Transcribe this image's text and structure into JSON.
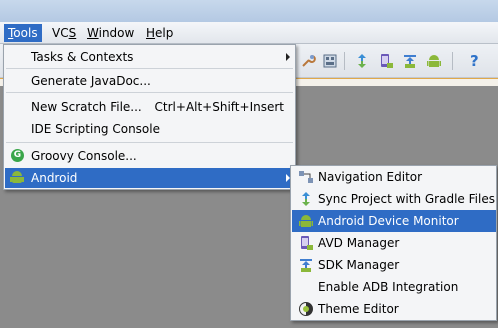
{
  "menubar": {
    "items": [
      "Tools",
      "VCS",
      "Window",
      "Help"
    ],
    "open": "Tools",
    "mnemonics": [
      "T",
      "S",
      "W",
      "H"
    ]
  },
  "tools_menu": {
    "items": [
      {
        "label": "Tasks & Contexts",
        "has_submenu": true
      },
      {
        "label": "Generate JavaDoc...",
        "has_submenu": false
      },
      {
        "label": "New Scratch File...",
        "shortcut": "Ctrl+Alt+Shift+Insert"
      },
      {
        "label": "IDE Scripting Console"
      },
      {
        "label": "Groovy Console...",
        "icon": "groovy-icon"
      },
      {
        "label": "Android",
        "icon": "android-icon",
        "has_submenu": true,
        "selected": true
      }
    ]
  },
  "android_submenu": {
    "items": [
      {
        "label": "Navigation Editor",
        "icon": "navigation-editor-icon"
      },
      {
        "label": "Sync Project with Gradle Files",
        "icon": "gradle-sync-icon"
      },
      {
        "label": "Android Device Monitor",
        "icon": "android-icon",
        "selected": true
      },
      {
        "label": "AVD Manager",
        "icon": "avd-manager-icon"
      },
      {
        "label": "SDK Manager",
        "icon": "sdk-manager-icon"
      },
      {
        "label": "Enable ADB Integration",
        "icon": ""
      },
      {
        "label": "Theme Editor",
        "icon": "theme-editor-icon"
      }
    ]
  },
  "toolbar": {
    "help_label": "?"
  },
  "colors": {
    "selection": "#2f6cc5",
    "menu_bg": "#f4f5f7",
    "android_green": "#8bb83a"
  }
}
